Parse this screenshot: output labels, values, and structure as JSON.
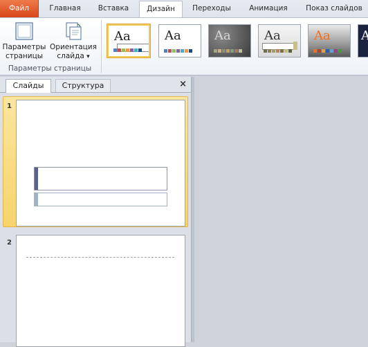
{
  "ribbon_tabs": {
    "file": "Файл",
    "home": "Главная",
    "insert": "Вставка",
    "design": "Дизайн",
    "transitions": "Переходы",
    "animation": "Анимация",
    "slideshow": "Показ слайдов"
  },
  "page_setup_group": {
    "page_params_line1": "Параметры",
    "page_params_line2": "страницы",
    "orientation_line1": "Ориентация",
    "orientation_line2": "слайда",
    "orientation_arrow": "▾",
    "group_label": "Параметры страницы"
  },
  "themes": [
    {
      "sample": "Aa",
      "text_color": "#000000",
      "bg": "#ffffff",
      "swatches": [
        "#4f81bd",
        "#c0504d",
        "#9bbb59",
        "#f79646",
        "#8064a2",
        "#4bacc6",
        "#1f497d"
      ]
    },
    {
      "sample": "Aa",
      "text_color": "#000000",
      "bg": "#ffffff",
      "swatches": [
        "#4f81bd",
        "#c0504d",
        "#9bbb59",
        "#8064a2",
        "#4bacc6",
        "#f79646",
        "#1f497d"
      ]
    },
    {
      "sample": "Aa",
      "text_color": "#e0e0e0",
      "bg": "#4a4a4a",
      "swatches": [
        "#a7a37e",
        "#c9b27c",
        "#8c8c6e",
        "#c0a060",
        "#7f9f7f",
        "#9f7f5f",
        "#bfbf9f"
      ]
    },
    {
      "sample": "Aa",
      "text_color": "#333333",
      "bg": "#e8e8e8",
      "swatches": [
        "#6f6f4f",
        "#8f7f4f",
        "#9f9f5f",
        "#c08050",
        "#7f6f3f",
        "#bfbf6f",
        "#5f5f3f"
      ]
    },
    {
      "sample": "Aa",
      "text_color": "#f07020",
      "bg": "#5a5a5a",
      "swatches": [
        "#f07020",
        "#c04020",
        "#e0a040",
        "#2060c0",
        "#60a0e0",
        "#a04080",
        "#40a040"
      ]
    },
    {
      "sample": "A",
      "text_color": "#ffffff",
      "bg": "#1c2340",
      "swatches": [
        "#4060c0",
        "#6080e0"
      ]
    }
  ],
  "left_pane": {
    "tab_slides": "Слайды",
    "tab_outline": "Структура",
    "close": "×",
    "slides": [
      {
        "number": "1"
      },
      {
        "number": "2"
      }
    ]
  },
  "colors": {
    "file_tab": "#d8471a",
    "selection": "#f7d36a",
    "title_bar_accent": "#5d5f8e",
    "subtitle_bar_accent": "#9fb3c8"
  }
}
